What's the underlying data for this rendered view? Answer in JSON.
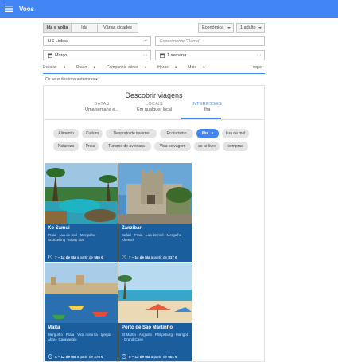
{
  "appbar": {
    "title": "Voos",
    "menu_icon": "hamburger-menu-icon"
  },
  "trip_type": {
    "options": [
      "Ida e volta",
      "Ida",
      "Várias cidades"
    ],
    "selected": "Ida e volta"
  },
  "cabin_class": {
    "value": "Económica"
  },
  "passengers": {
    "value": "1 adulto"
  },
  "origin": {
    "value": "LIS Lisboa",
    "swap_icon": "plus-icon"
  },
  "destination": {
    "placeholder": "Experimente \"Roma\""
  },
  "depart_date": {
    "value": "Março",
    "icon": "calendar-icon"
  },
  "duration": {
    "value": "1 semana",
    "icon": "calendar-icon"
  },
  "filters": {
    "items": [
      "Escalas",
      "Preço",
      "Companhia aérea",
      "Horas",
      "Mais"
    ],
    "clear": "Limpar"
  },
  "previous_destinations": {
    "label": "Os seus destinos anteriores"
  },
  "discover": {
    "title": "Descobrir viagens",
    "tabs": [
      {
        "title": "DATAS",
        "value": "Uma semana e..."
      },
      {
        "title": "LOCAIS",
        "value": "Em qualquer local"
      },
      {
        "title": "INTERESSES",
        "value": "Ilha"
      }
    ],
    "active_tab": "INTERESSES"
  },
  "interests": {
    "row1": [
      "Alimento",
      "Cultura",
      "Desporto de inverno",
      "Ecoturismo",
      "Ilha",
      "Lua de mel"
    ],
    "row2": [
      "Natureza",
      "Praia",
      "Turismo de aventura",
      "Vida selvagem",
      "ao ar livre",
      "compras"
    ],
    "selected": "Ilha"
  },
  "results": [
    {
      "name": "Ko Samui",
      "tags": "Praia · Lua de mel · Mergulho · Snorkelling · Muay thai",
      "dates": "7 – 14 de Ma",
      "price_prefix": "a partir de",
      "price": "566 €"
    },
    {
      "name": "Zanzibar",
      "tags": "Safari · Praia · Lua de mel · Mergulho · Kitesurf",
      "dates": "7 – 14 de Ma",
      "price_prefix": "a partir de",
      "price": "817 €"
    },
    {
      "name": "Malta",
      "tags": "Mergulho · Praia · Vida noturna · Igrejas · Abra · Caravaggio",
      "dates": "4 – 12 de Ma",
      "price_prefix": "a partir de",
      "price": "276 €"
    },
    {
      "name": "Porto de São Martinho",
      "tags": "St Martin · Anguilla · Philipsburg · Marigot · Grand Case",
      "dates": "5 – 13 de Ma",
      "price_prefix": "a partir de",
      "price": "601 €"
    }
  ],
  "colors": {
    "accent": "#4285f4",
    "card": "#1a5e9e"
  }
}
